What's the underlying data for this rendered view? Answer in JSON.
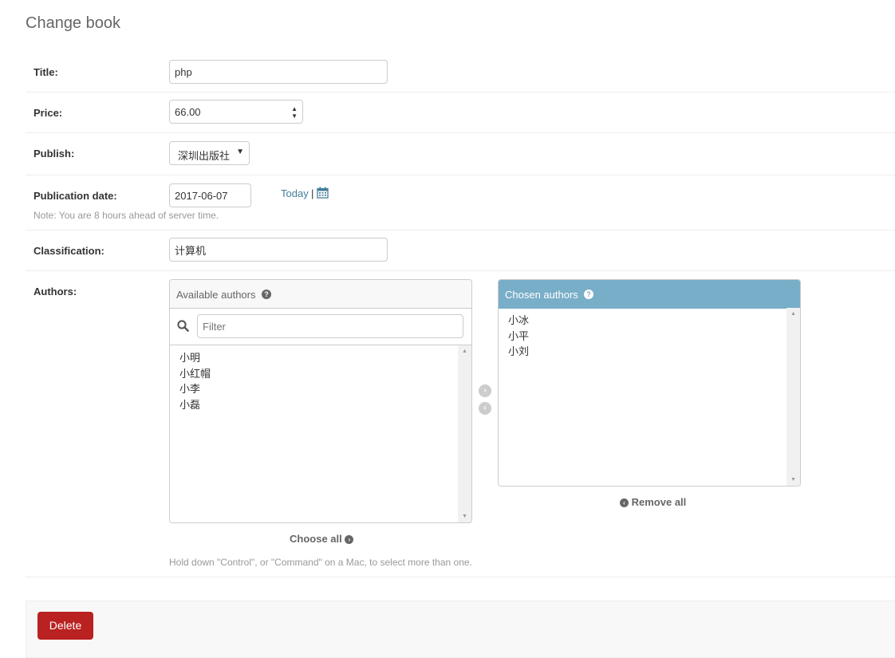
{
  "page": {
    "title": "Change book"
  },
  "fields": {
    "title": {
      "label": "Title:",
      "value": "php"
    },
    "price": {
      "label": "Price:",
      "value": "66.00"
    },
    "publish": {
      "label": "Publish:",
      "selected": "深圳出版社"
    },
    "publication_date": {
      "label": "Publication date:",
      "value": "2017-06-07",
      "today_label": "Today",
      "separator": "|",
      "note": "Note: You are 8 hours ahead of server time."
    },
    "classification": {
      "label": "Classification:",
      "value": "计算机"
    },
    "authors": {
      "label": "Authors:",
      "available_title": "Available authors",
      "filter_placeholder": "Filter",
      "available": [
        "小明",
        "小红帽",
        "小李",
        "小磊"
      ],
      "chosen_title": "Chosen authors",
      "chosen": [
        "小冰",
        "小平",
        "小刘"
      ],
      "choose_all": "Choose all",
      "remove_all": "Remove all",
      "help": "Hold down \"Control\", or \"Command\" on a Mac, to select more than one."
    }
  },
  "actions": {
    "delete_label": "Delete"
  },
  "colors": {
    "accent": "#79aec8",
    "link": "#447e9b",
    "delete": "#ba2121"
  },
  "icons": [
    "calendar-icon",
    "question-icon",
    "search-icon",
    "chevron-right-icon",
    "chevron-left-icon"
  ]
}
